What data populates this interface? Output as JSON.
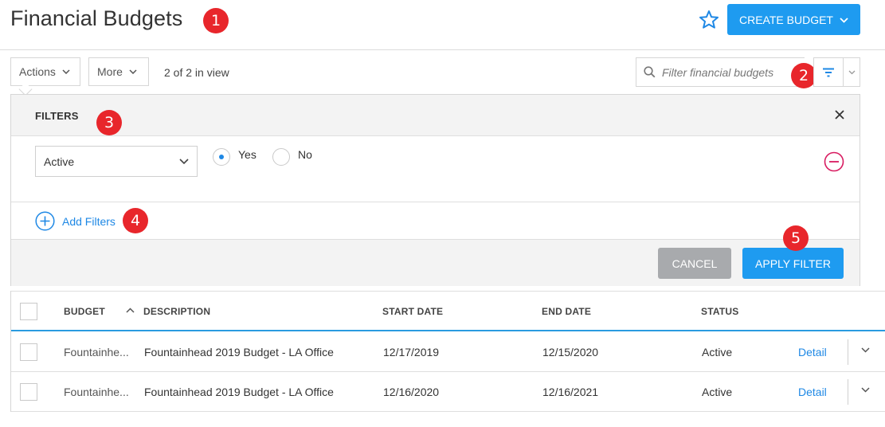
{
  "header": {
    "title": "Financial Budgets",
    "create_label": "CREATE BUDGET"
  },
  "badges": [
    "1",
    "2",
    "3",
    "4",
    "5"
  ],
  "toolbar": {
    "actions_label": "Actions",
    "more_label": "More",
    "view_count": "2 of 2 in view",
    "search_placeholder": "Filter financial budgets"
  },
  "filters": {
    "title": "FILTERS",
    "field": "Active",
    "options": [
      "Yes",
      "No"
    ],
    "selected": "Yes",
    "add_label": "Add Filters",
    "cancel_label": "CANCEL",
    "apply_label": "APPLY FILTER"
  },
  "table": {
    "columns": [
      "BUDGET",
      "DESCRIPTION",
      "START DATE",
      "END DATE",
      "STATUS"
    ],
    "rows": [
      {
        "budget": "Fountainhe...",
        "description": "Fountainhead 2019 Budget - LA Office",
        "start": "12/17/2019",
        "end": "12/15/2020",
        "status": "Active",
        "action": "Detail"
      },
      {
        "budget": "Fountainhe...",
        "description": "Fountainhead 2019 Budget - LA Office",
        "start": "12/16/2020",
        "end": "12/16/2021",
        "status": "Active",
        "action": "Detail"
      }
    ]
  },
  "colors": {
    "primary": "#1e9bf0",
    "badge": "#e8262b",
    "link": "#1e88e5",
    "remove": "#d81b60",
    "cancel": "#a8aaad"
  }
}
